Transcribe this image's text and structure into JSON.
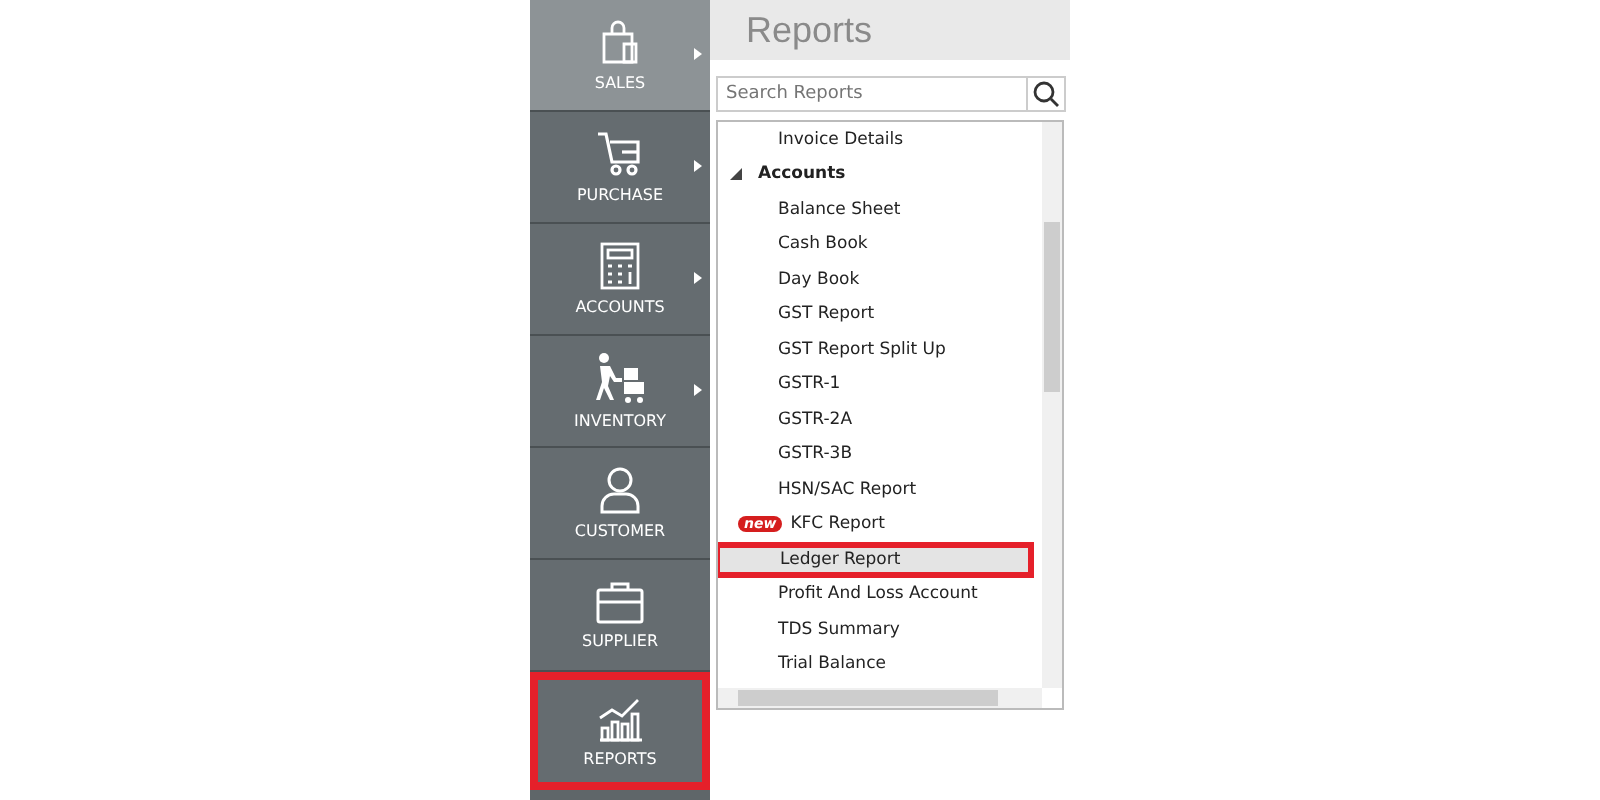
{
  "sidebar": {
    "items": [
      {
        "label": "SALES",
        "kind": "bag",
        "has_submenu": true,
        "hovered": true,
        "selected": false
      },
      {
        "label": "PURCHASE",
        "kind": "cart",
        "has_submenu": true,
        "hovered": false,
        "selected": false
      },
      {
        "label": "ACCOUNTS",
        "kind": "calculator",
        "has_submenu": true,
        "hovered": false,
        "selected": false
      },
      {
        "label": "INVENTORY",
        "kind": "trolley",
        "has_submenu": true,
        "hovered": false,
        "selected": false
      },
      {
        "label": "CUSTOMER",
        "kind": "person",
        "has_submenu": false,
        "hovered": false,
        "selected": false
      },
      {
        "label": "SUPPLIER",
        "kind": "briefcase",
        "has_submenu": false,
        "hovered": false,
        "selected": false
      },
      {
        "label": "REPORTS",
        "kind": "chart",
        "has_submenu": false,
        "hovered": false,
        "selected": true
      }
    ]
  },
  "panel": {
    "title": "Reports",
    "search": {
      "placeholder": "Search Reports"
    },
    "tree": [
      {
        "kind": "item",
        "label": "Invoice Details",
        "selected": false
      },
      {
        "kind": "group",
        "label": "Accounts",
        "expanded": true,
        "children": [
          {
            "label": "Balance Sheet",
            "selected": false
          },
          {
            "label": "Cash Book",
            "selected": false
          },
          {
            "label": "Day Book",
            "selected": false
          },
          {
            "label": "GST Report",
            "selected": false
          },
          {
            "label": "GST Report Split Up",
            "selected": false
          },
          {
            "label": "GSTR-1",
            "selected": false
          },
          {
            "label": "GSTR-2A",
            "selected": false
          },
          {
            "label": "GSTR-3B",
            "selected": false
          },
          {
            "label": "HSN/SAC Report",
            "selected": false
          },
          {
            "label": "KFC Report",
            "badge": "new",
            "selected": false
          },
          {
            "label": "Ledger Report",
            "selected": true
          },
          {
            "label": "Profit And Loss Account",
            "selected": false
          },
          {
            "label": "TDS Summary",
            "selected": false
          },
          {
            "label": "Trial Balance",
            "selected": false
          }
        ]
      }
    ]
  }
}
